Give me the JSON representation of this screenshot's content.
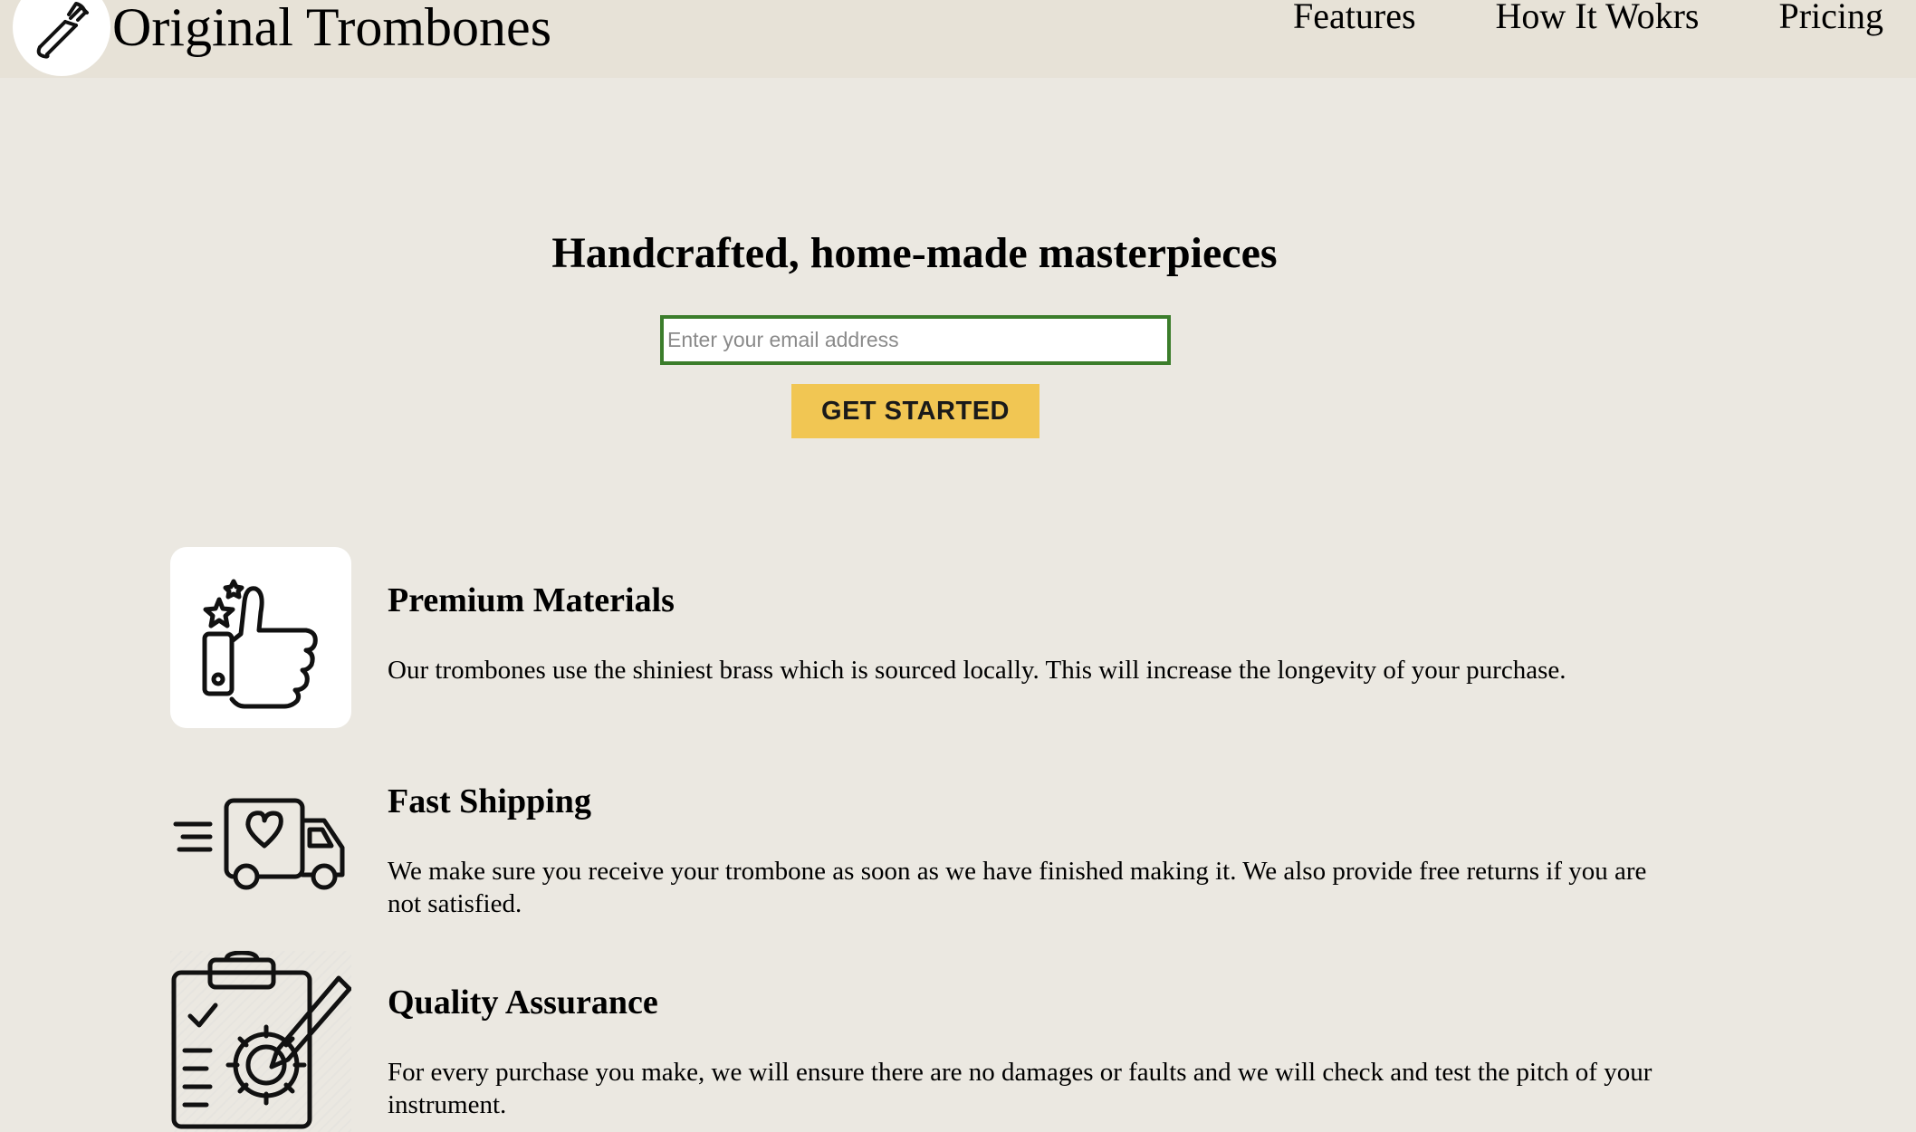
{
  "header": {
    "brand": "Original Trombones",
    "logo_icon": "trombone-icon",
    "nav": [
      {
        "label": "Features"
      },
      {
        "label": "How It Wokrs"
      },
      {
        "label": "Pricing"
      }
    ]
  },
  "hero": {
    "title": "Handcrafted, home-made masterpieces",
    "email_placeholder": "Enter your email address",
    "email_value": "",
    "cta_label": "GET STARTED"
  },
  "features": [
    {
      "icon": "thumbs-up-icon",
      "title": "Premium Materials",
      "description": "Our trombones use the shiniest brass which is sourced locally. This will increase the longevity of your purchase."
    },
    {
      "icon": "delivery-truck-icon",
      "title": "Fast Shipping",
      "description": "We make sure you receive your trombone as soon as we have finished making it. We also provide free returns if you are not satisfied."
    },
    {
      "icon": "quality-clipboard-icon",
      "title": "Quality Assurance",
      "description": "For every purchase you make, we will ensure there are no damages or faults and we will check and test the pitch of your instrument."
    }
  ],
  "colors": {
    "page_background": "#ebe8e1",
    "header_background": "#e7e2d7",
    "cta_background": "#f1c653",
    "input_border": "#3b7d2b"
  }
}
